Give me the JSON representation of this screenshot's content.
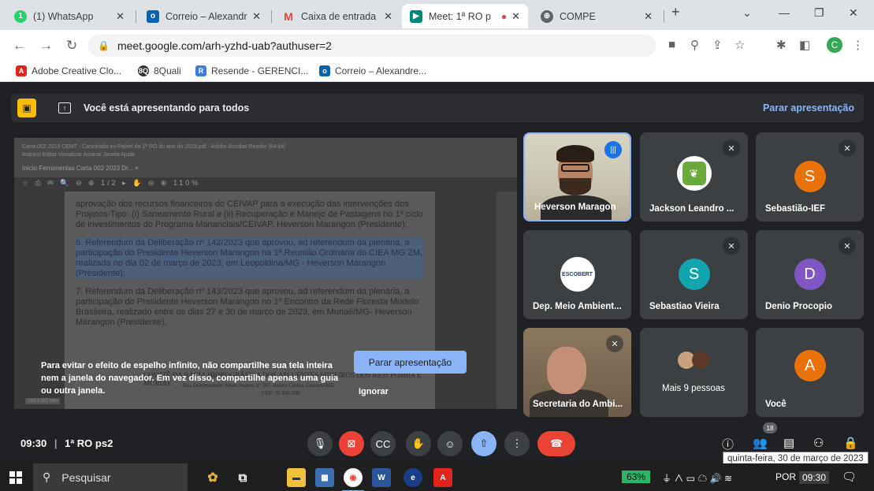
{
  "browser": {
    "tabs": [
      {
        "label": "(1) WhatsApp",
        "icon": "whatsapp-icon",
        "color": "#25d366",
        "glyph": "1"
      },
      {
        "label": "Correio – Alexandr",
        "icon": "outlook-icon",
        "color": "#0a64ad",
        "glyph": "o"
      },
      {
        "label": "Caixa de entrada (",
        "icon": "gmail-icon",
        "color": "#ea4335",
        "glyph": "M"
      },
      {
        "label": "Meet: 1ª RO p",
        "icon": "meet-icon",
        "color": "#00897b",
        "glyph": "▶"
      },
      {
        "label": "COMPE",
        "icon": "globe-icon",
        "color": "#5f6368",
        "glyph": "⊕"
      }
    ],
    "new_tab": "+",
    "url": "meet.google.com/arh-yzhd-uab?authuser=2",
    "profile_initial": "C",
    "bookmarks": [
      {
        "label": "Adobe Creative Clo...",
        "color": "#e1251b",
        "glyph": "A"
      },
      {
        "label": "8Quali",
        "color": "#333333",
        "glyph": "8Q"
      },
      {
        "label": "Resende - GERENCI...",
        "color": "#3b7fd9",
        "glyph": "R"
      },
      {
        "label": "Correio – Alexandre...",
        "color": "#0a64ad",
        "glyph": "o"
      }
    ]
  },
  "meet": {
    "presenting_banner": "Você está apresentando para todos",
    "stop_presenting": "Parar apresentação",
    "screen": {
      "title_bar": "Carta 002 2023 CEMT - Cancelado ex-Painel da 1ª RO do ano de 2023.pdf - Adobe Acrobat Reader (64-bit)",
      "menu": "Arquivo   Editar   Visualizar   Assinar   Janela   Ajuda",
      "tabs": "Início     Ferramentas     Carta 002 2023  Dr...  ×",
      "tools": "☆ ⎙ ✉ 🔍 ⊖ ⊕ 1/2 ▸ ✋ ⊖ ⊕ 110%",
      "paragraphs": [
        "aprovação dos recursos financeiros do CEIVAP para a execução das intervenções dos Projetos-Tipo: (i) Saneamento Rural e (ii) Recuperação e Manejo de Pastagens no 1º ciclo de investimentos do Programa Mananciais/CEIVAP. Heverson Marangon (Presidente);",
        "6. Referendum da Deliberação nº 142/2023 que aprovou, ad referendum da plenária, a participação do Presidente Heverson Marangon na 1ª Reunião Ordinária do CIEA MG ZM, realizada no dia 02 de março de 2023, em Leopoldina/MG - Heverson Marangon (Presidente);",
        "7. Referendum da Deliberação nº 143/2023 que aprovou, ad referendum da plenária, a participação do Presidente Heverson Marangon no 1º Encontro da Rede Floresta Modelo Brasileira, realizado entre os dias 27 e 30 de março de 2023, em Muriaé/MG- Heverson Marangon (Presidente);"
      ],
      "footer": "COMITÊ DA BACIA HIDROGRÁFICA DOS AFLUENTES MINEIROS DOS RIOS POMBA E MURIAÉ",
      "footer2": "Rua Dorymedonte Alves Soares, nº 587, Bairro Caulas, Guarani/MG",
      "footer3": "CEP: 36.160-000",
      "page_size": "210 x 297 mm"
    },
    "mirror_warning": "Para evitar o efeito de espelho infinito, não compartilhe sua tela inteira nem a janela do navegador. Em vez disso, compartilhe apenas uma guia ou outra janela.",
    "mirror_stop_button": "Parar apresentação",
    "mirror_ignore": "Ignorar",
    "participants": [
      {
        "name": "Heverson Maragon",
        "type": "video",
        "speaking": true
      },
      {
        "name": "Jackson Leandro ...",
        "type": "logo",
        "muted": true
      },
      {
        "name": "Sebastião-IEF",
        "type": "initial",
        "initial": "S",
        "color": "#e8710a",
        "muted": true
      },
      {
        "name": "Dep. Meio Ambient...",
        "type": "logo2",
        "logo_text": "ESCOBERT"
      },
      {
        "name": "Sebastiao Vieira",
        "type": "initial",
        "initial": "S",
        "color": "#12a4af",
        "muted": true
      },
      {
        "name": "Denio Procopio",
        "type": "initial",
        "initial": "D",
        "color": "#7e57c2",
        "muted": true
      },
      {
        "name": "Secretaria do Ambi...",
        "type": "video2",
        "muted": true
      },
      {
        "name": "Mais 9 pessoas",
        "type": "more"
      },
      {
        "name": "Você",
        "type": "initial",
        "initial": "A",
        "color": "#e8710a"
      }
    ],
    "meeting_time": "09:30",
    "meeting_name": "1ª RO ps2",
    "participants_count": "18",
    "tooltip": "quinta-feira, 30 de março de 2023"
  },
  "taskbar": {
    "search_placeholder": "Pesquisar",
    "battery": "63%",
    "language": "POR",
    "clock": "09:30"
  }
}
